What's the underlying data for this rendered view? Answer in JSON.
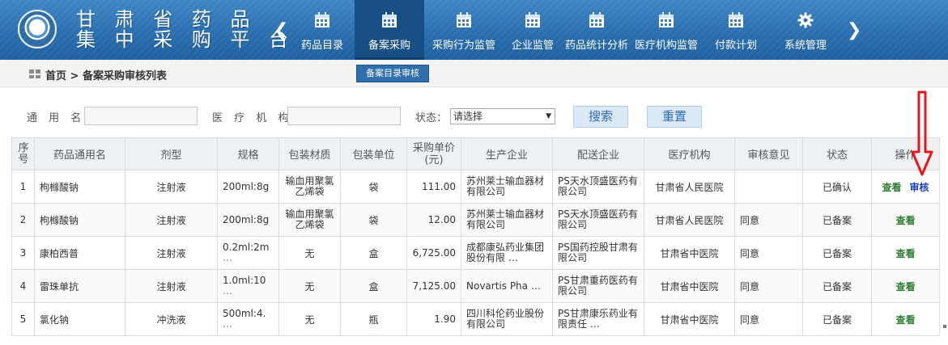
{
  "header": {
    "brand_line1": "甘 肃 省 药 品",
    "brand_line2": "集 中 采 购 平 台",
    "nav": [
      {
        "label": "药品目录",
        "icon": "calendar-icon",
        "active": false
      },
      {
        "label": "备案采购",
        "icon": "calendar-icon",
        "active": true
      },
      {
        "label": "采购行为监管",
        "icon": "calendar-icon",
        "active": false
      },
      {
        "label": "企业监管",
        "icon": "calendar-icon",
        "active": false
      },
      {
        "label": "药品统计分析",
        "icon": "calendar-icon",
        "active": false
      },
      {
        "label": "医疗机构监管",
        "icon": "calendar-icon",
        "active": false
      },
      {
        "label": "付款计划",
        "icon": "calendar-icon",
        "active": false
      },
      {
        "label": "系统管理",
        "icon": "gear-icon",
        "active": false
      }
    ],
    "subnav_label": "备案目录审核"
  },
  "breadcrumb": {
    "text": "首页 > 备案采购审核列表"
  },
  "search": {
    "generic_name_label": "通 用 名：",
    "institution_label": "医 疗 机 构：",
    "status_label": "状态：",
    "status_selected": "请选择",
    "search_button": "搜索",
    "reset_button": "重置"
  },
  "table": {
    "headers": {
      "seq": "序号",
      "name": "药品通用名",
      "form": "剂型",
      "spec": "规格",
      "pack_material": "包装材质",
      "pack_unit": "包装单位",
      "price": "采购单价(元)",
      "manufacturer": "生产企业",
      "distributor": "配送企业",
      "institution": "医疗机构",
      "opinion": "审核意见",
      "status": "状态",
      "actions": "操作"
    },
    "rows": [
      {
        "seq": "1",
        "name": "枸橼酸钠",
        "form": "注射液",
        "spec": "200ml:8g",
        "pack_material": "输血用聚氯乙烯袋",
        "pack_unit": "袋",
        "price": "111.00",
        "manufacturer": "苏州莱士输血器材有限公司",
        "distributor": "PS天水顶盛医药有限公司",
        "institution": "甘肃省人民医院",
        "opinion": "",
        "status": "已确认",
        "view": "查看",
        "audit": "审核"
      },
      {
        "seq": "2",
        "name": "枸橼酸钠",
        "form": "注射液",
        "spec": "200ml:8g",
        "pack_material": "输血用聚氯乙烯袋",
        "pack_unit": "袋",
        "price": "12.00",
        "manufacturer": "苏州莱士输血器材有限公司",
        "distributor": "PS天水顶盛医药有限公司",
        "institution": "甘肃省人民医院",
        "opinion": "同意",
        "status": "已备案",
        "view": "查看",
        "audit": ""
      },
      {
        "seq": "3",
        "name": "康柏西普",
        "form": "注射液",
        "spec": "0.2ml:2m",
        "pack_material": "无",
        "pack_unit": "盒",
        "price": "6,725.00",
        "manufacturer": "成都康弘药业集团股份有限 …",
        "distributor": "PS国药控股甘肃有限公司",
        "institution": "甘肃省中医院",
        "opinion": "同意",
        "status": "已备案",
        "view": "查看",
        "audit": ""
      },
      {
        "seq": "4",
        "name": "雷珠单抗",
        "form": "注射液",
        "spec": "1.0ml:10",
        "pack_material": "无",
        "pack_unit": "盒",
        "price": "7,125.00",
        "manufacturer": "Novartis Pha …",
        "distributor": "PS甘肃重药医药有限公司",
        "institution": "甘肃省中医院",
        "opinion": "同意",
        "status": "已备案",
        "view": "查看",
        "audit": ""
      },
      {
        "seq": "5",
        "name": "氯化钠",
        "form": "冲洗液",
        "spec": "500ml:4.",
        "pack_material": "无",
        "pack_unit": "瓶",
        "price": "1.90",
        "manufacturer": "四川科伦药业股份有限公司",
        "distributor": "PS甘肃康乐药业有限责任 …",
        "institution": "甘肃省中医院",
        "opinion": "同意",
        "status": "已备案",
        "view": "查看",
        "audit": ""
      }
    ],
    "ellipsis": "…"
  },
  "colors": {
    "header_blue": "#2a6fb0",
    "active_nav": "#174f85",
    "view_link": "#2e7d32",
    "audit_link": "#1a3fc4",
    "annotation_red": "#e8161b"
  }
}
